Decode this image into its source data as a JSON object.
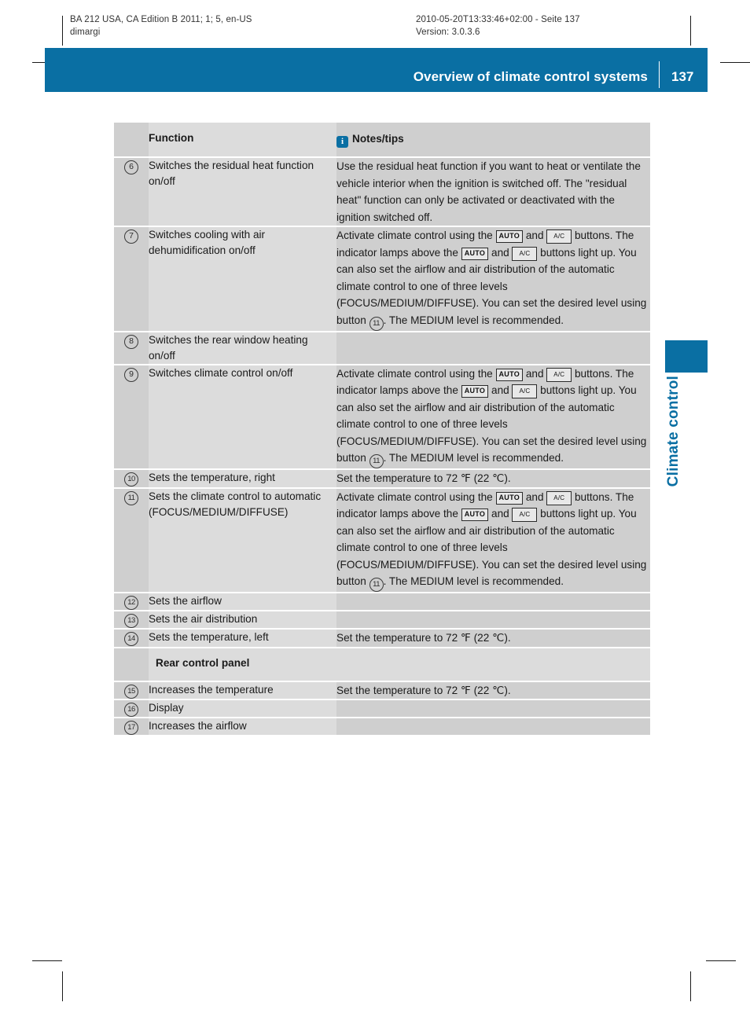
{
  "print_info": {
    "left_line1": "BA 212 USA, CA Edition B 2011; 1; 5, en-US",
    "left_line2": "dimargi",
    "right_line1": "2010-05-20T13:33:46+02:00 - Seite 137",
    "right_line2": "Version: 3.0.3.6"
  },
  "header": {
    "title": "Overview of climate control systems",
    "page_number": "137",
    "accent_color": "#0a6fa3"
  },
  "side_tab": {
    "label": "Climate control"
  },
  "table": {
    "columns": {
      "function": "Function",
      "notes": "Notes/tips",
      "notes_icon": "info-icon"
    },
    "buttons": {
      "auto": "AUTO",
      "ac": "A/C"
    },
    "shared_note": {
      "p1": "Activate climate control using the ",
      "p2": " and ",
      "p3": " buttons. The indicator lamps above the ",
      "p4": " and ",
      "p5": " buttons light up. You can also set the airflow and air distribution of the automatic climate control to one of three levels (FOCUS/MEDIUM/DIFFUSE). You can set the desired level using button ",
      "ref": "11",
      "p6": ". The MEDIUM level is recommended."
    },
    "rows": [
      {
        "num": "6",
        "function": "Switches the residual heat function on/off",
        "note": "Use the residual heat function if you want to heat or ventilate the vehicle interior when the ignition is switched off. The \"residual heat\" function can only be activated or deactivated with the ignition switched off."
      },
      {
        "num": "7",
        "function": "Switches cooling with air dehumidification on/off",
        "note": "__SHARED__"
      },
      {
        "num": "8",
        "function": "Switches the rear window heating on/off",
        "note": ""
      },
      {
        "num": "9",
        "function": "Switches climate control on/off",
        "note": "__SHARED__"
      },
      {
        "num": "10",
        "function": "Sets the temperature, right",
        "note": "Set the temperature to 72 ℉ (22 ℃)."
      },
      {
        "num": "11",
        "function": "Sets the climate control to automatic (FOCUS/MEDIUM/DIFFUSE)",
        "note": "__SHARED__"
      },
      {
        "num": "12",
        "function": "Sets the airflow",
        "note": ""
      },
      {
        "num": "13",
        "function": "Sets the air distribution",
        "note": ""
      },
      {
        "num": "14",
        "function": "Sets the temperature, left",
        "note": "Set the temperature to 72 ℉ (22 ℃)."
      },
      {
        "num": "",
        "section_title": "Rear control panel"
      },
      {
        "num": "15",
        "function": "Increases the temperature",
        "note": "Set the temperature to 72 ℉ (22 ℃)."
      },
      {
        "num": "16",
        "function": "Display",
        "note": ""
      },
      {
        "num": "17",
        "function": "Increases the airflow",
        "note": ""
      }
    ]
  }
}
